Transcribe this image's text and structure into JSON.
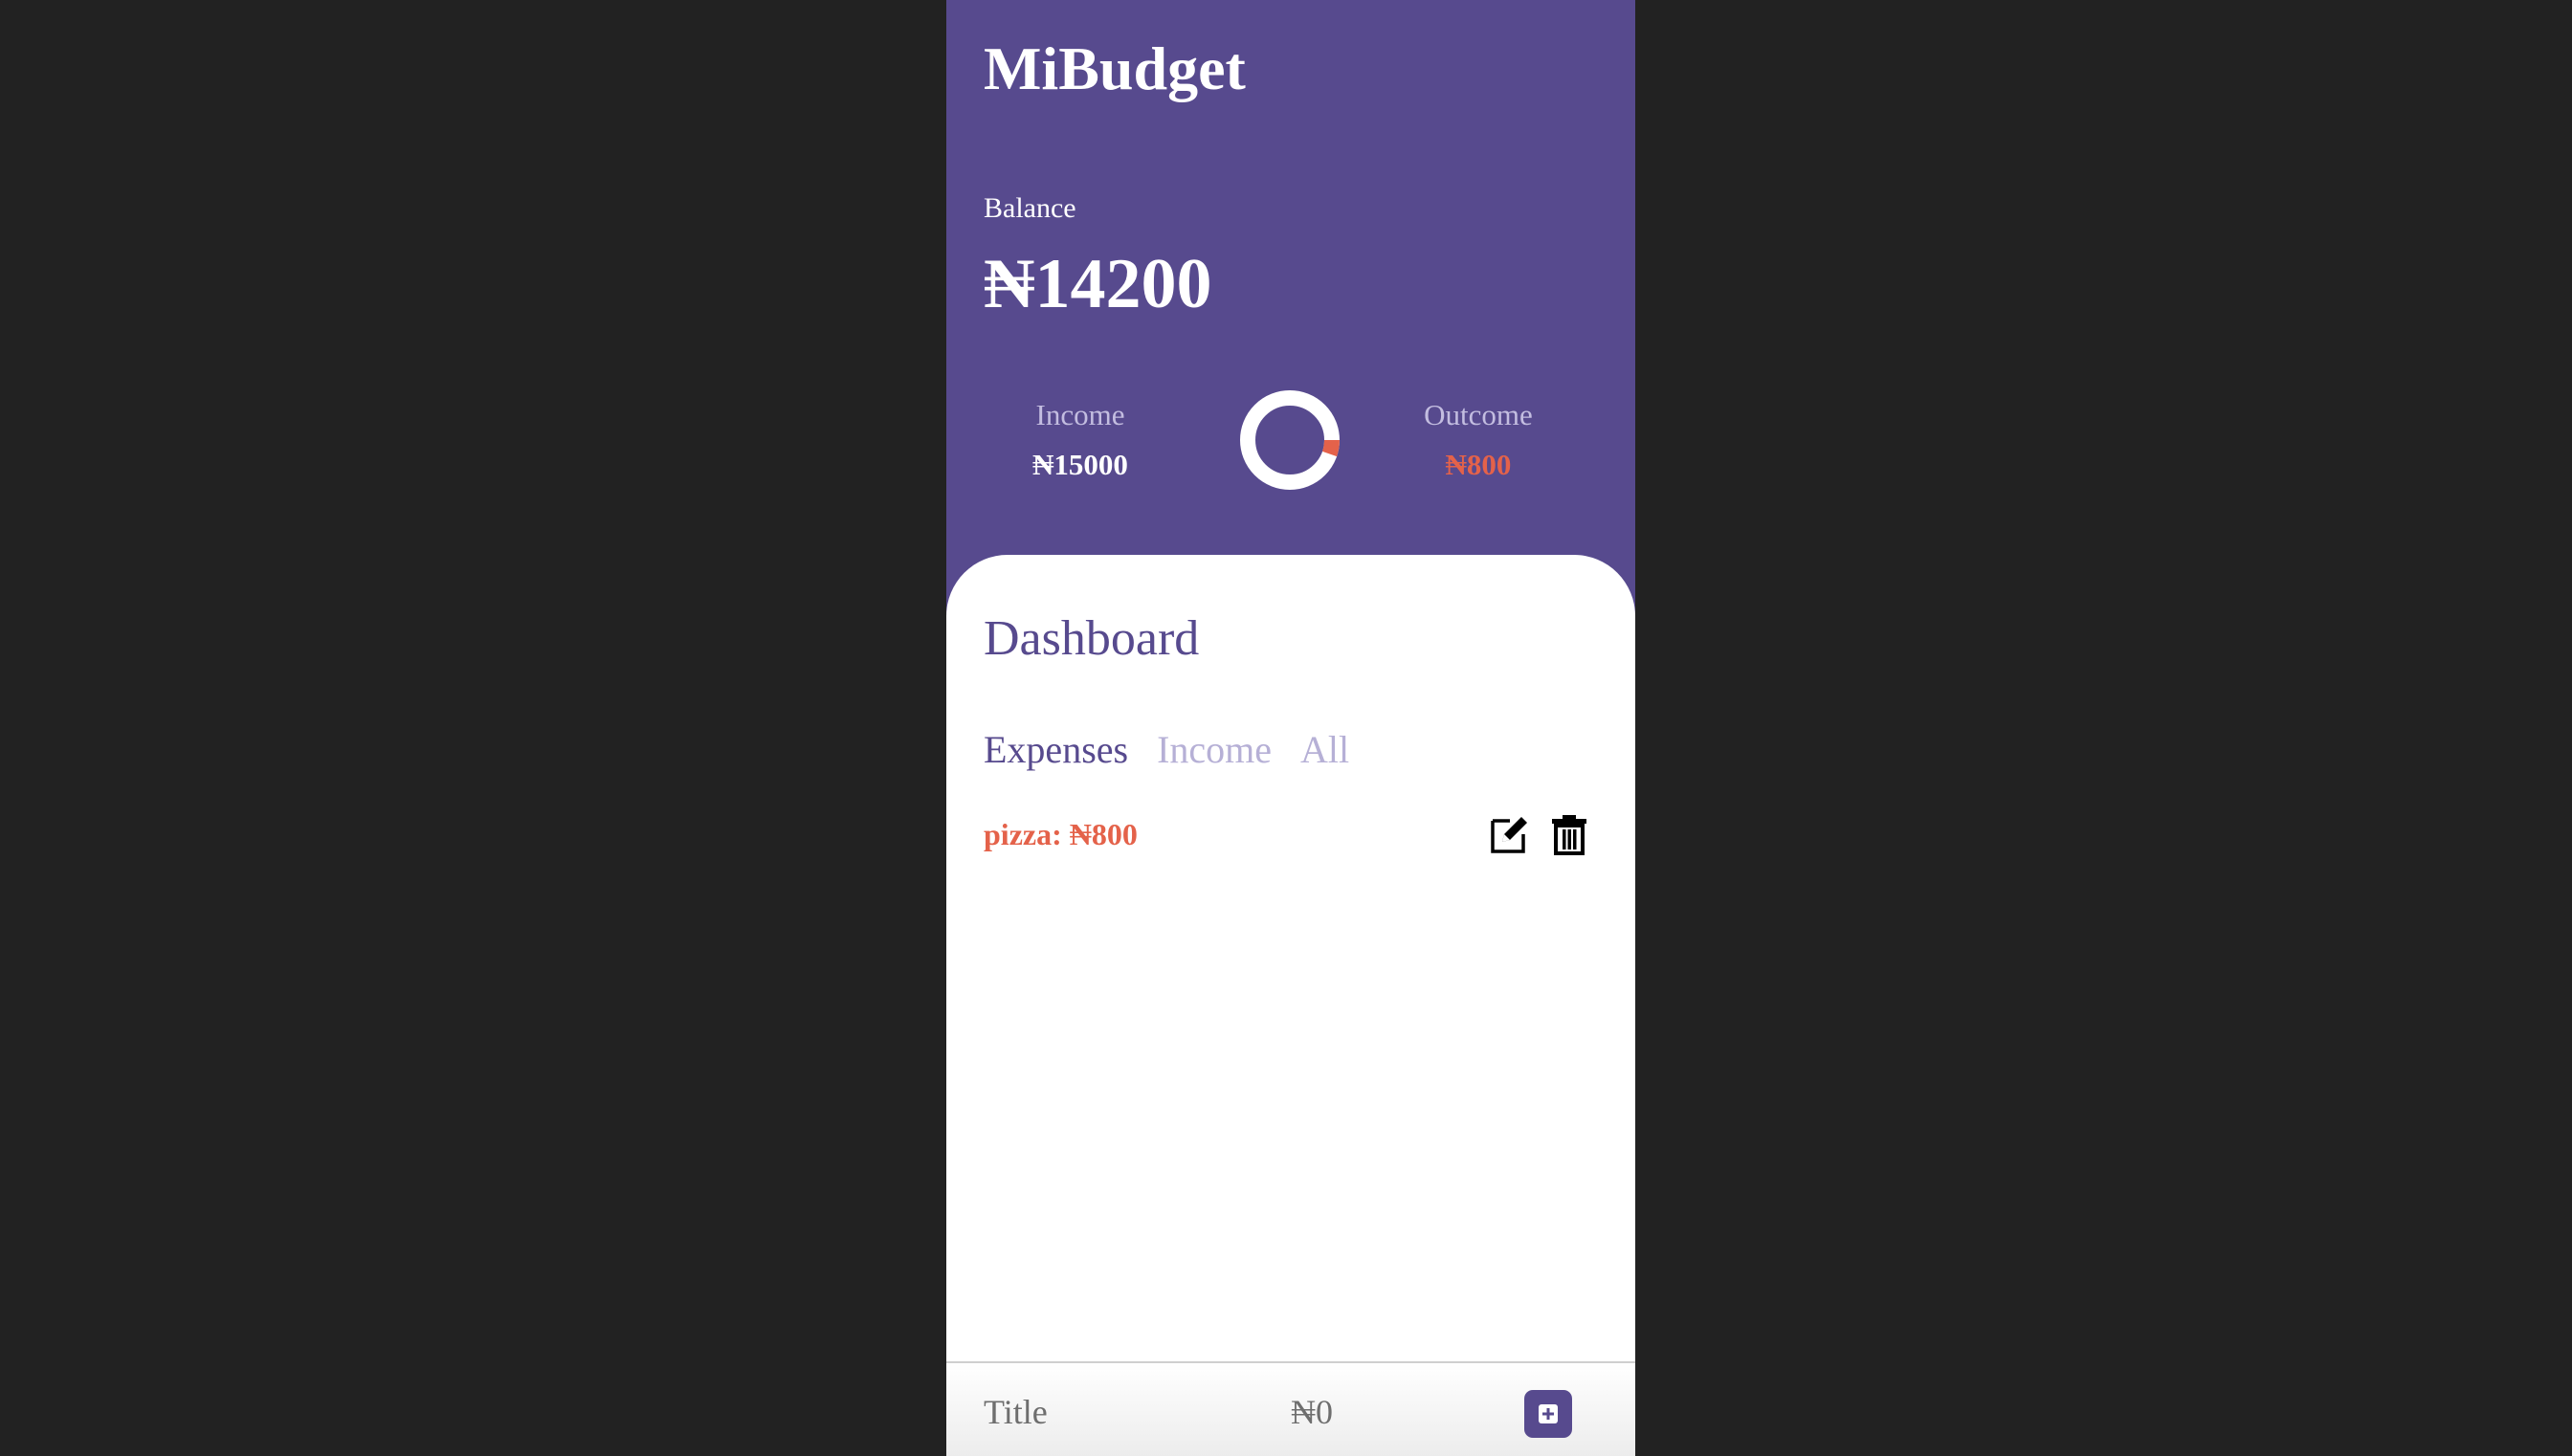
{
  "app": {
    "title": "MiBudget"
  },
  "balance": {
    "label": "Balance",
    "value": "₦14200"
  },
  "income": {
    "label": "Income",
    "value": "₦15000"
  },
  "outcome": {
    "label": "Outcome",
    "value": "₦800"
  },
  "donut": {
    "income_amount": 15000,
    "outcome_amount": 800,
    "ring_color": "#ffffff",
    "outcome_color": "#e4624a"
  },
  "dashboard": {
    "title": "Dashboard",
    "tabs": [
      {
        "label": "Expenses",
        "active": true
      },
      {
        "label": "Income",
        "active": false
      },
      {
        "label": "All",
        "active": false
      }
    ],
    "entries": [
      {
        "title": "pizza:",
        "amount": "₦800",
        "edit_icon": "edit-icon",
        "delete_icon": "trash-icon"
      }
    ]
  },
  "form": {
    "title_placeholder": "Title",
    "amount_placeholder": "₦0",
    "add_icon": "plus-square-icon"
  },
  "colors": {
    "brand": "#574a8e",
    "expense": "#e4624a",
    "inactive_tab": "#b6b0d6",
    "background": "#222222"
  }
}
